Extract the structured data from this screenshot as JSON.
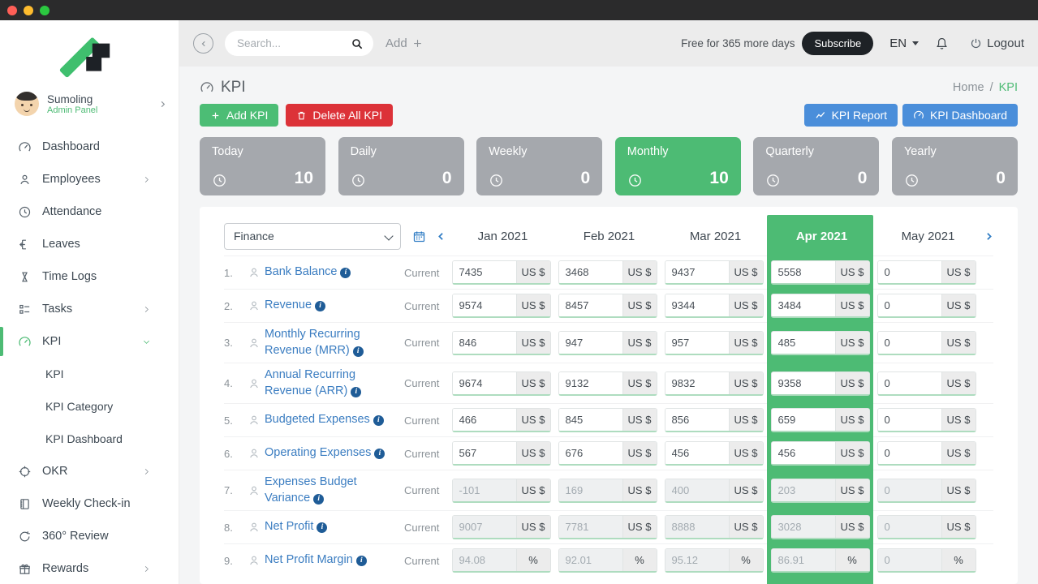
{
  "colors": {
    "accent_green": "#4dbb74",
    "danger_red": "#dc3238",
    "primary_blue": "#4a8eda",
    "link_blue": "#3b7dc1",
    "card_gray": "#a5a8ad",
    "subscribe_black": "#1e2226"
  },
  "window": {
    "traffic_lights": [
      "close",
      "minimize",
      "zoom"
    ]
  },
  "sidebar": {
    "brand": {
      "name": "Sumoling",
      "subtitle": "Admin Panel"
    },
    "items": [
      {
        "label": "Dashboard",
        "icon": "dashboard-gauge-icon"
      },
      {
        "label": "Employees",
        "icon": "person-icon",
        "chevron": "right"
      },
      {
        "label": "Attendance",
        "icon": "clock-icon"
      },
      {
        "label": "Leaves",
        "icon": "leave-icon"
      },
      {
        "label": "Time Logs",
        "icon": "hourglass-icon"
      },
      {
        "label": "Tasks",
        "icon": "tasks-icon",
        "chevron": "right"
      },
      {
        "label": "KPI",
        "icon": "kpi-gauge-icon",
        "chevron": "down",
        "active": true,
        "submenu": [
          "KPI",
          "KPI Category",
          "KPI Dashboard"
        ]
      },
      {
        "label": "OKR",
        "icon": "target-icon",
        "chevron": "right"
      },
      {
        "label": "Weekly Check-in",
        "icon": "notebook-icon"
      },
      {
        "label": "360° Review",
        "icon": "cycle-icon"
      },
      {
        "label": "Rewards",
        "icon": "gift-icon",
        "chevron": "right"
      }
    ]
  },
  "topbar": {
    "search_placeholder": "Search...",
    "add_label": "Add",
    "trial_text": "Free for 365 more days",
    "subscribe_label": "Subscribe",
    "language": "EN",
    "logout_label": "Logout"
  },
  "page": {
    "title": "KPI",
    "breadcrumb": {
      "home": "Home",
      "sep": "/",
      "current": "KPI"
    },
    "actions": {
      "add_kpi": "Add KPI",
      "delete_all_kpi": "Delete All KPI",
      "kpi_report": "KPI Report",
      "kpi_dashboard": "KPI Dashboard"
    }
  },
  "stats": [
    {
      "label": "Today",
      "value": "10",
      "highlight": false
    },
    {
      "label": "Daily",
      "value": "0",
      "highlight": false
    },
    {
      "label": "Weekly",
      "value": "0",
      "highlight": false
    },
    {
      "label": "Monthly",
      "value": "10",
      "highlight": true
    },
    {
      "label": "Quarterly",
      "value": "0",
      "highlight": false
    },
    {
      "label": "Yearly",
      "value": "0",
      "highlight": false
    }
  ],
  "table": {
    "category_filter": "Finance",
    "months": [
      "Jan 2021",
      "Feb 2021",
      "Mar 2021",
      "Apr 2021",
      "May 2021"
    ],
    "highlight_month_index": 3,
    "row_label": "Current",
    "rows": [
      {
        "num": "1.",
        "name": "Bank Balance",
        "unit": "US $",
        "values": [
          "7435",
          "3468",
          "9437",
          "5558",
          "0"
        ],
        "disabled": false
      },
      {
        "num": "2.",
        "name": "Revenue",
        "unit": "US $",
        "values": [
          "9574",
          "8457",
          "9344",
          "3484",
          "0"
        ],
        "disabled": false
      },
      {
        "num": "3.",
        "name": "Monthly Recurring Revenue (MRR)",
        "unit": "US $",
        "values": [
          "846",
          "947",
          "957",
          "485",
          "0"
        ],
        "disabled": false
      },
      {
        "num": "4.",
        "name": "Annual Recurring Revenue (ARR)",
        "unit": "US $",
        "values": [
          "9674",
          "9132",
          "9832",
          "9358",
          "0"
        ],
        "disabled": false
      },
      {
        "num": "5.",
        "name": "Budgeted Expenses",
        "unit": "US $",
        "values": [
          "466",
          "845",
          "856",
          "659",
          "0"
        ],
        "disabled": false
      },
      {
        "num": "6.",
        "name": "Operating Expenses",
        "unit": "US $",
        "values": [
          "567",
          "676",
          "456",
          "456",
          "0"
        ],
        "disabled": false
      },
      {
        "num": "7.",
        "name": "Expenses Budget Variance",
        "unit": "US $",
        "values": [
          "-101",
          "169",
          "400",
          "203",
          "0"
        ],
        "disabled": true
      },
      {
        "num": "8.",
        "name": "Net Profit",
        "unit": "US $",
        "values": [
          "9007",
          "7781",
          "8888",
          "3028",
          "0"
        ],
        "disabled": true
      },
      {
        "num": "9.",
        "name": "Net Profit Margin",
        "unit": "%",
        "values": [
          "94.08",
          "92.01",
          "95.12",
          "86.91",
          "0"
        ],
        "disabled": true
      }
    ]
  }
}
